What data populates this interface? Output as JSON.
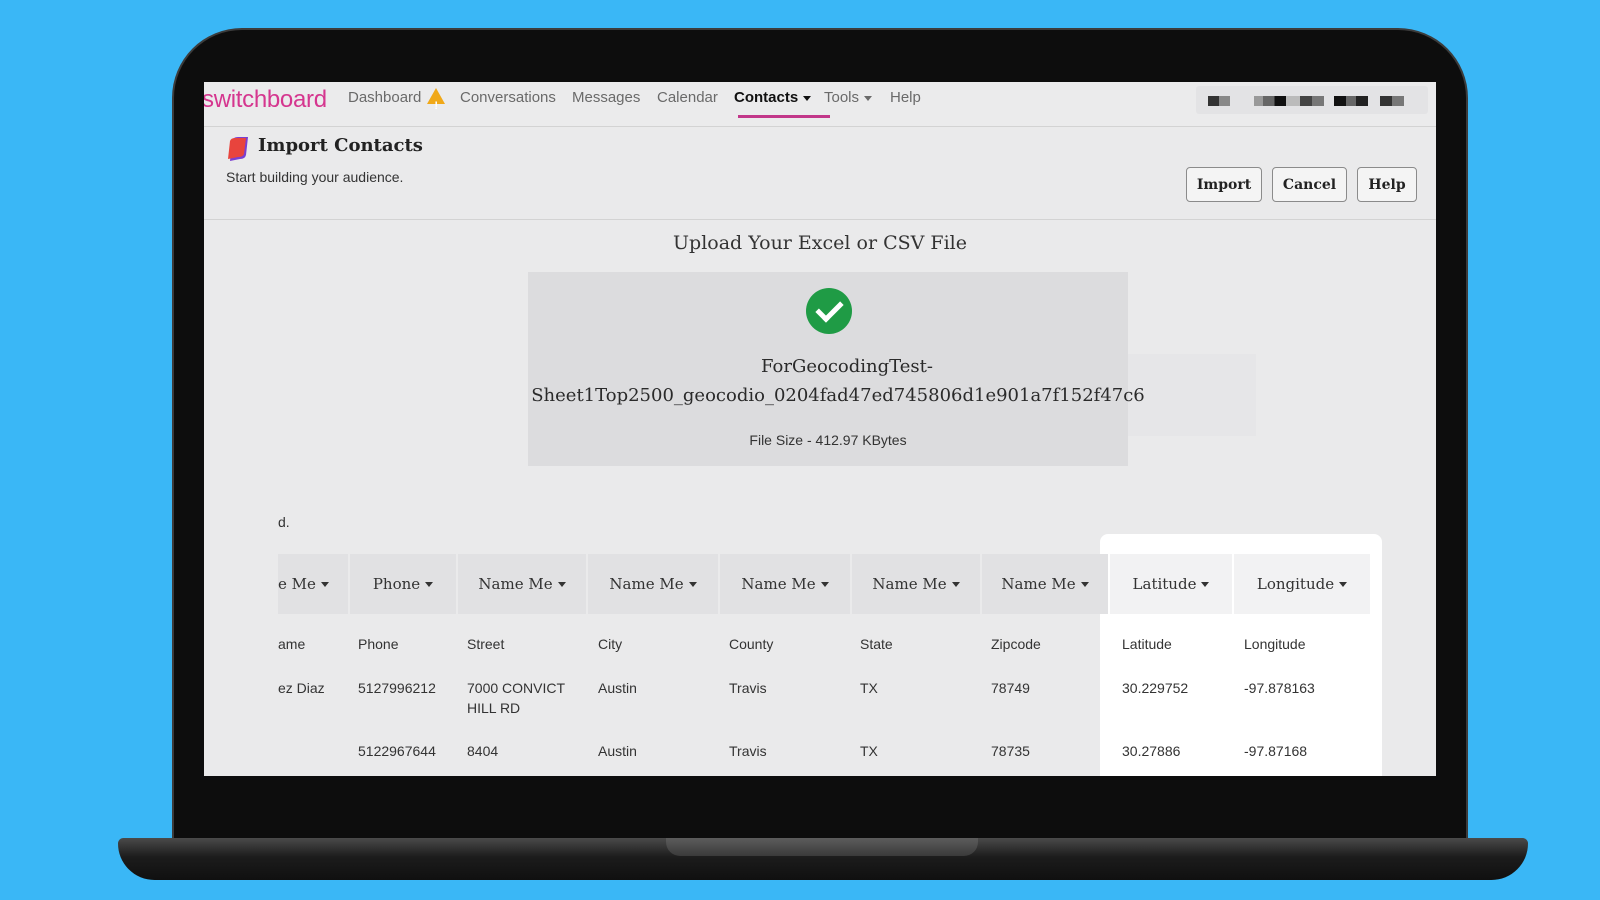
{
  "nav": {
    "brand": "switchboard",
    "items": [
      {
        "label": "Dashboard"
      },
      {
        "label": "Conversations"
      },
      {
        "label": "Messages"
      },
      {
        "label": "Calendar"
      },
      {
        "label": "Contacts"
      },
      {
        "label": "Tools"
      },
      {
        "label": "Help"
      }
    ],
    "active": "Contacts"
  },
  "header": {
    "title": "Import Contacts",
    "subtitle": "Start building your audience.",
    "buttons": {
      "import": "Import",
      "cancel": "Cancel",
      "help": "Help"
    }
  },
  "upload": {
    "title": "Upload Your Excel or CSV File",
    "filename_line1": "ForGeocodingTest-",
    "filename_line2": "Sheet1Top2500_geocodio_0204fad47ed745806d1e901a7f152f47c6",
    "filesize": "File Size - 412.97 KBytes"
  },
  "partial_text": "d.",
  "table": {
    "mapping_headers": [
      "e Me",
      "Phone",
      "Name Me",
      "Name Me",
      "Name Me",
      "Name Me",
      "Name Me",
      "Latitude",
      "Longitude"
    ],
    "column_names": [
      "ame",
      "Phone",
      "Street",
      "City",
      "County",
      "State",
      "Zipcode",
      "Latitude",
      "Longitude"
    ],
    "rows": [
      [
        "ez Diaz",
        "5127996212",
        "7000 CONVICT",
        "HILL RD",
        "Austin",
        "Travis",
        "TX",
        "78749",
        "30.229752",
        "-97.878163"
      ],
      [
        "",
        "5122967644",
        "8404",
        "",
        "Austin",
        "Travis",
        "TX",
        "78735",
        "30.27886",
        "-97.87168"
      ]
    ]
  },
  "colors": {
    "brand": "#d5368f",
    "accent_underline": "#c2378a",
    "success": "#1f9b45",
    "warning": "#f0a818",
    "background": "#3ab7f6"
  }
}
